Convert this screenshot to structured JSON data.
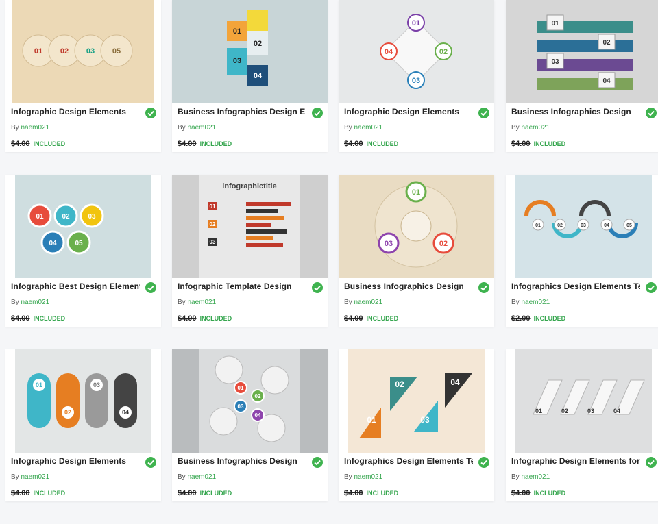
{
  "colors": {
    "accent": "#36a64f",
    "check": "#3fb34f",
    "background": "#f5f6f8"
  },
  "product_labels": {
    "by": "By",
    "included": "INCLUDED"
  },
  "cards": [
    {
      "title": "Infographic Design Elements",
      "author": "naem021",
      "price": "$4.00",
      "thumb_badges": [
        "01",
        "02",
        "03",
        "05"
      ]
    },
    {
      "title": "Business Infographics Design Ele",
      "author": "naem021",
      "price": "$4.00",
      "thumb_badges": [
        "01",
        "02",
        "03",
        "04"
      ]
    },
    {
      "title": "Infographic Design Elements",
      "author": "naem021",
      "price": "$4.00",
      "thumb_badges": [
        "01",
        "02",
        "03",
        "04"
      ]
    },
    {
      "title": "Business Infographics Design",
      "author": "naem021",
      "price": "$4.00",
      "thumb_badges": [
        "01",
        "02",
        "03",
        "04"
      ]
    },
    {
      "title": "Infographic Best Design Element",
      "author": "naem021",
      "price": "$4.00",
      "thumb_badges": [
        "01",
        "02",
        "03",
        "04",
        "05"
      ]
    },
    {
      "title": "Infographic Template Design",
      "author": "naem021",
      "price": "$4.00",
      "thumb_badges": [
        "01",
        "02",
        "03"
      ],
      "thumb_title": "infographictitle"
    },
    {
      "title": "Business Infographics Design",
      "author": "naem021",
      "price": "$4.00",
      "thumb_badges": [
        "01",
        "02",
        "03"
      ]
    },
    {
      "title": "Infographics Design Elements Te",
      "author": "naem021",
      "price": "$2.00",
      "thumb_badges": [
        "01",
        "02",
        "03",
        "04",
        "05"
      ]
    },
    {
      "title": "Infographic Design Elements",
      "author": "naem021",
      "price": "$4.00",
      "thumb_badges": [
        "01",
        "02",
        "03",
        "04"
      ]
    },
    {
      "title": "Business Infographics Design",
      "author": "naem021",
      "price": "$4.00",
      "thumb_badges": [
        "01",
        "02",
        "03",
        "04"
      ]
    },
    {
      "title": "Infographics Design Elements Te",
      "author": "naem021",
      "price": "$4.00",
      "thumb_badges": [
        "01",
        "02",
        "03",
        "04"
      ]
    },
    {
      "title": "Infographic Design Elements for",
      "author": "naem021",
      "price": "$4.00",
      "thumb_badges": [
        "01",
        "02",
        "03",
        "04"
      ]
    }
  ]
}
